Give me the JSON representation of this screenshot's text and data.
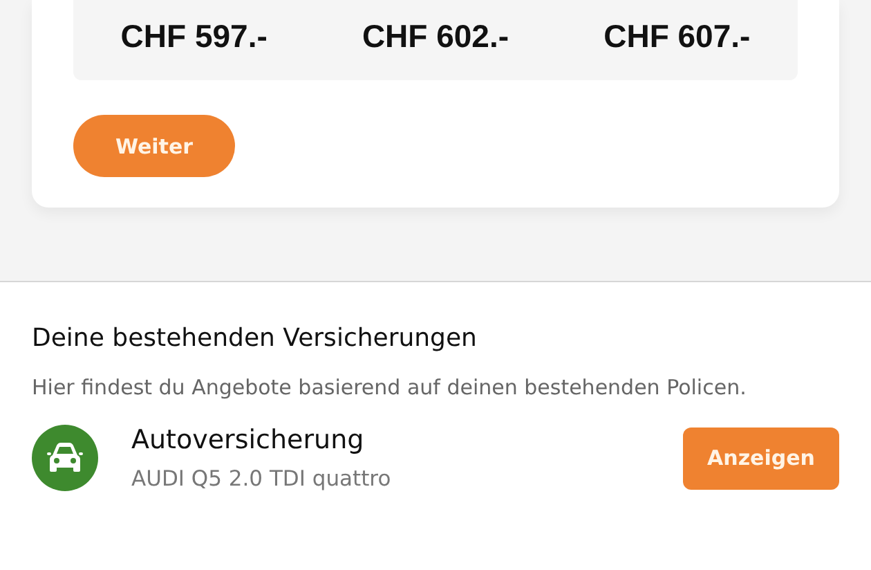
{
  "prices": [
    "CHF 597.-",
    "CHF 602.-",
    "CHF 607.-"
  ],
  "continue_button": "Weiter",
  "section": {
    "title": "Deine bestehenden Versicherungen",
    "description": "Hier findest du Angebote basierend auf deinen bestehenden Policen.",
    "items": [
      {
        "title": "Autoversicherung",
        "subtitle": "AUDI Q5 2.0 TDI quattro",
        "button": "Anzeigen"
      }
    ]
  }
}
